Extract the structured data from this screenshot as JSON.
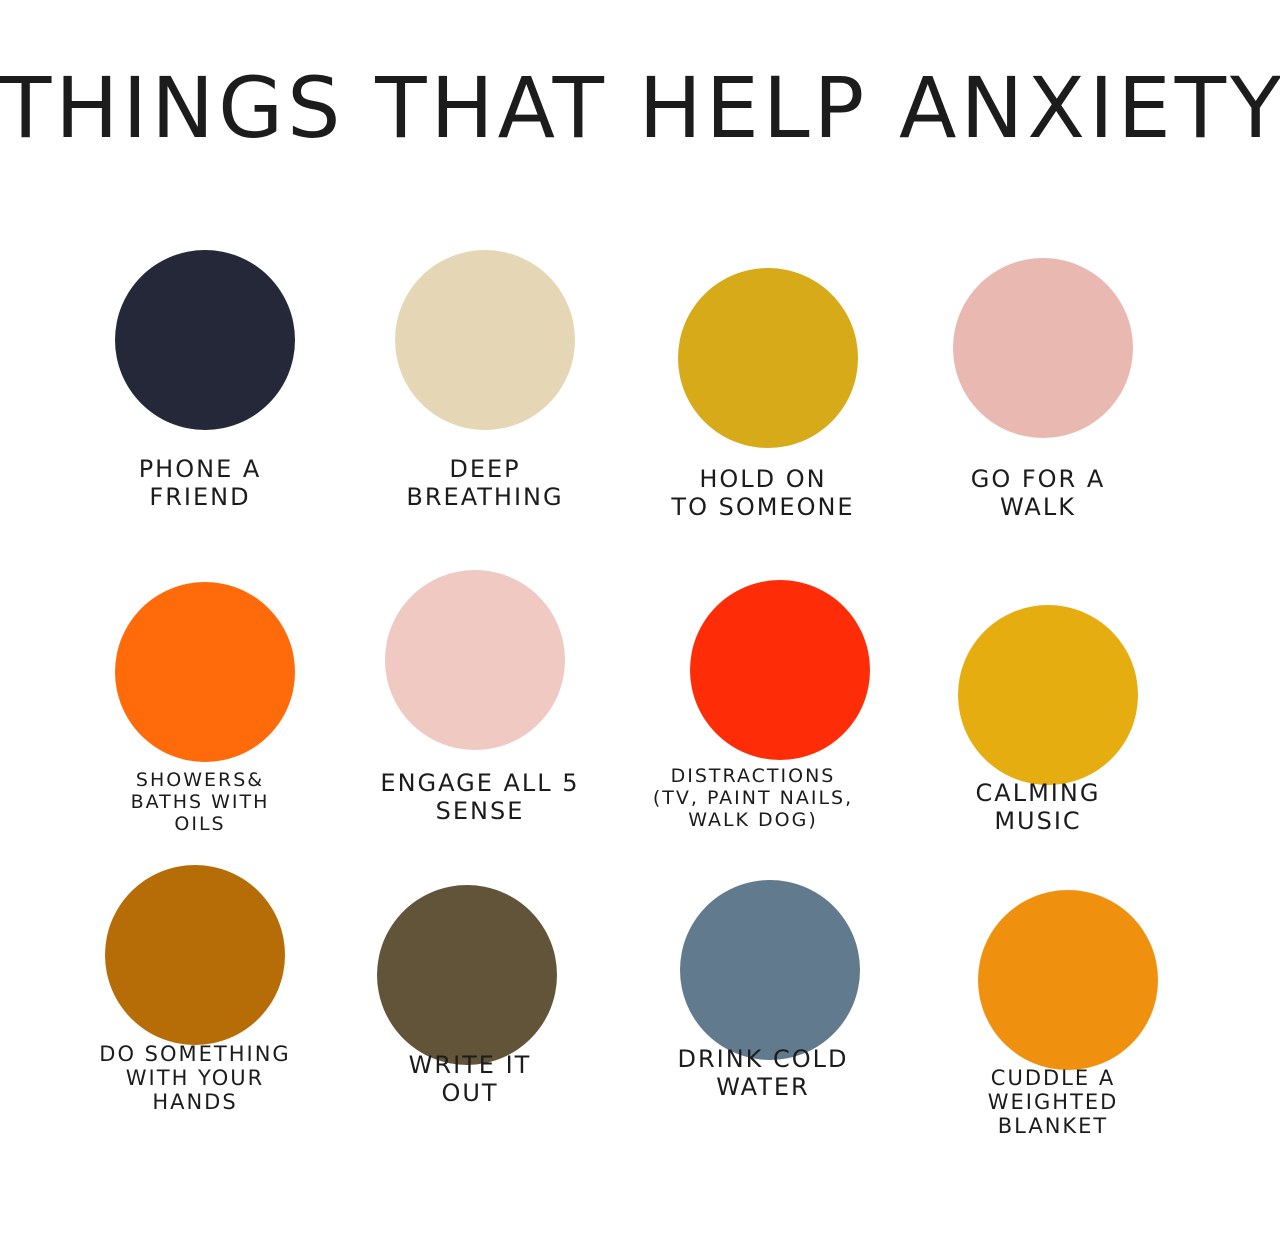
{
  "title": "THINGS THAT HELP ANXIETY",
  "items": [
    {
      "lines": [
        "PHONE A",
        "FRIEND"
      ],
      "color": "#242838"
    },
    {
      "lines": [
        "DEEP",
        "BREATHING"
      ],
      "color": "#e5d7b6"
    },
    {
      "lines": [
        "HOLD ON",
        "TO SOMEONE"
      ],
      "color": "#d6aa18"
    },
    {
      "lines": [
        "GO FOR A",
        "WALK"
      ],
      "color": "#e9b8b1"
    },
    {
      "lines": [
        "SHOWERS&",
        "BATHS WITH",
        "OILS"
      ],
      "color": "#ff6a0a"
    },
    {
      "lines": [
        "ENGAGE ALL 5",
        "SENSE"
      ],
      "color": "#f0c9c3"
    },
    {
      "lines": [
        "DISTRACTIONS",
        "(TV, PAINT NAILS,",
        "WALK DOG)"
      ],
      "color": "#ff2d07"
    },
    {
      "lines": [
        "CALMING",
        "MUSIC"
      ],
      "color": "#e6ad10"
    },
    {
      "lines": [
        "DO SOMETHING",
        "WITH YOUR",
        "HANDS"
      ],
      "color": "#b66d07"
    },
    {
      "lines": [
        "WRITE IT",
        "OUT"
      ],
      "color": "#615439"
    },
    {
      "lines": [
        "DRINK COLD",
        "WATER"
      ],
      "color": "#627a8d"
    },
    {
      "lines": [
        "CUDDLE A",
        "WEIGHTED",
        "BLANKET"
      ],
      "color": "#f0900f"
    }
  ]
}
